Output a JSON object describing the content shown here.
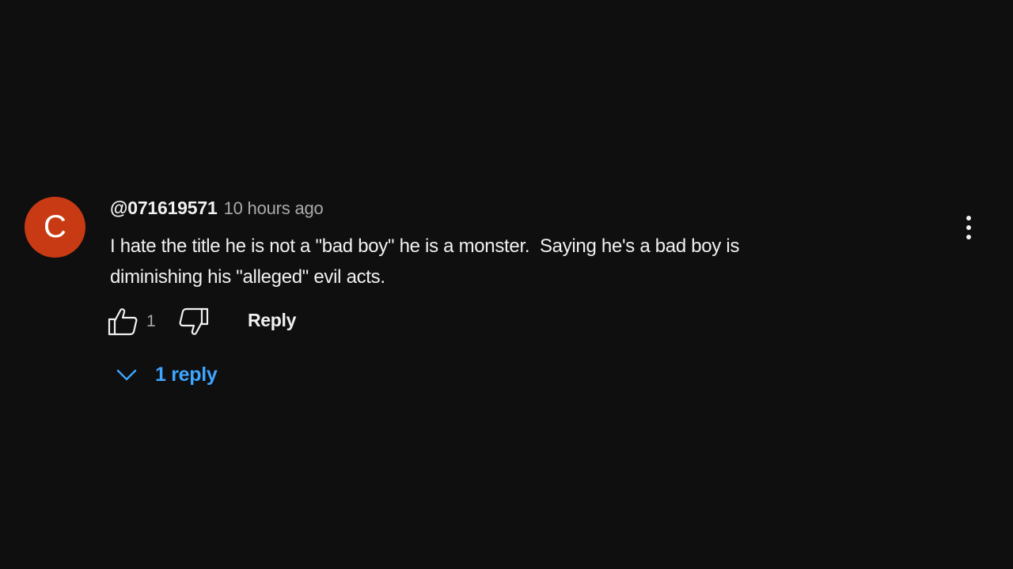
{
  "comment": {
    "avatar_letter": "C",
    "avatar_color": "#c83a14",
    "author": "@071619571",
    "timestamp": "10 hours ago",
    "text": "I hate the title he is not a \"bad boy\" he is a monster.  Saying he's a bad boy is\ndiminishing his \"alleged\" evil acts.",
    "like_count": "1",
    "reply_label": "Reply",
    "replies_label": "1 reply",
    "accent_color": "#3ea6ff"
  },
  "icons": {
    "like": "thumbs-up-icon",
    "dislike": "thumbs-down-icon",
    "expand": "chevron-down-icon",
    "more": "more-vertical-icon"
  }
}
